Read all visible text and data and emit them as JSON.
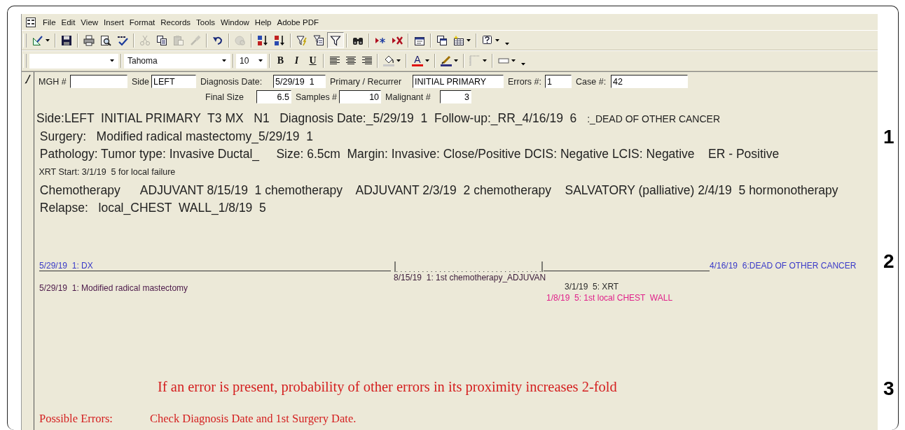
{
  "menu": {
    "items": [
      "File",
      "Edit",
      "View",
      "Insert",
      "Format",
      "Records",
      "Tools",
      "Window",
      "Help",
      "Adobe PDF"
    ]
  },
  "toolbar_1": {
    "groups": [
      {
        "buttons": [
          {
            "kind": "design",
            "disabled": false,
            "selected": false
          }
        ]
      },
      {
        "buttons": [
          {
            "kind": "save",
            "disabled": false,
            "selected": false
          }
        ]
      },
      {
        "buttons": [
          {
            "kind": "print",
            "disabled": false,
            "selected": false
          },
          {
            "kind": "preview",
            "disabled": false,
            "selected": false
          },
          {
            "kind": "spelling",
            "disabled": false,
            "selected": false
          }
        ]
      },
      {
        "buttons": [
          {
            "kind": "cut",
            "disabled": true,
            "selected": false
          },
          {
            "kind": "copy",
            "disabled": false,
            "selected": false
          },
          {
            "kind": "paste",
            "disabled": true,
            "selected": false
          },
          {
            "kind": "painter",
            "disabled": true,
            "selected": false
          }
        ]
      },
      {
        "buttons": [
          {
            "kind": "undo",
            "disabled": false,
            "selected": false
          }
        ]
      },
      {
        "buttons": [
          {
            "kind": "hyperlink",
            "disabled": true,
            "selected": false
          }
        ]
      },
      {
        "buttons": [
          {
            "kind": "sort_asc",
            "disabled": false,
            "selected": false
          },
          {
            "kind": "sort_desc",
            "disabled": false,
            "selected": false
          }
        ]
      },
      {
        "buttons": [
          {
            "kind": "filter_selection",
            "disabled": false,
            "selected": false
          },
          {
            "kind": "filter_form",
            "disabled": false,
            "selected": false
          },
          {
            "kind": "filter",
            "disabled": false,
            "selected": true
          }
        ]
      },
      {
        "buttons": [
          {
            "kind": "find",
            "disabled": false,
            "selected": false
          }
        ]
      },
      {
        "buttons": [
          {
            "kind": "new_record",
            "disabled": false,
            "selected": false
          },
          {
            "kind": "delete_record",
            "disabled": false,
            "selected": false
          }
        ]
      },
      {
        "buttons": [
          {
            "kind": "properties",
            "disabled": false,
            "selected": false
          }
        ]
      },
      {
        "buttons": [
          {
            "kind": "database_window",
            "disabled": false,
            "selected": false
          },
          {
            "kind": "new_object",
            "disabled": false,
            "selected": false
          }
        ]
      },
      {
        "buttons": [
          {
            "kind": "help",
            "disabled": false,
            "selected": false
          }
        ]
      }
    ]
  },
  "toolbar_2": {
    "font": "Tahoma",
    "font_size": "10",
    "format_buttons": [
      {
        "kind": "bold",
        "label": "B"
      },
      {
        "kind": "italic",
        "label": "I"
      },
      {
        "kind": "underline",
        "label": "U"
      }
    ],
    "color_buttons": [
      {
        "kind": "fill",
        "color": "#c8c8c8"
      },
      {
        "kind": "font",
        "label": "A",
        "color": "#e01010"
      },
      {
        "kind": "line",
        "color": "#303080"
      }
    ]
  },
  "form": {
    "header_fields": [
      {
        "label": "MGH #"
      },
      {
        "label": "Side",
        "value": "LEFT"
      },
      {
        "label": "Diagnosis Date:",
        "value": "5/29/19  1"
      },
      {
        "label": "Primary / Recurrer",
        "value": "INITIAL PRIMARY"
      },
      {
        "label": "Errors #:",
        "value": "1"
      },
      {
        "label": "Case #:",
        "value": "42"
      }
    ],
    "size_fields": [
      {
        "label": "Final Size",
        "value": "6.5"
      },
      {
        "label": "Samples #",
        "value": "10"
      },
      {
        "label": "Malignant #",
        "value": "3"
      }
    ]
  },
  "summary": {
    "marker": "1",
    "lines": [
      {
        "kind": "normal",
        "text": "Side:LEFT  INITIAL PRIMARY  T3 MX   N1   Diagnosis Date:_5/29/19  1  Follow-up:_RR_4/16/19  6",
        "note": ":_DEAD OF OTHER CANCER"
      },
      {
        "kind": "normal",
        "text": " Surgery:   Modified radical mastectomy_5/29/19  1"
      },
      {
        "kind": "normal",
        "text": " Pathology: Tumor type: Invasive Ductal_     Size: 6.5cm  Margin: Invasive: Close/Positive DCIS: Negative LCIS: Negative    ER - Positive"
      },
      {
        "kind": "small",
        "text": " XRT Start: 3/1/19  5 for local failure"
      },
      {
        "kind": "normal",
        "text": " Chemotherapy      ADJUVANT 8/15/19  1 chemotherapy    ADJUVANT 2/3/19  2 chemotherapy    SALVATORY (palliative) 2/4/19  5 hormonotherapy"
      },
      {
        "kind": "normal",
        "text": " Relapse:   local_CHEST  WALL_1/8/19  5"
      }
    ]
  },
  "timeline": {
    "marker": "2",
    "events": [
      {
        "text": "5/29/19  1: DX",
        "color": "#3a3ac8"
      },
      {
        "text": "4/16/19  6:DEAD OF OTHER CANCER",
        "color": "#3a3ac8"
      },
      {
        "text": "5/29/19  1: Modified radical mastectomy",
        "color": "#4a1848"
      },
      {
        "text": "8/15/19  1: 1st chemotherapy_ADJUVAN",
        "color": "#3a1a38"
      },
      {
        "text": "3/1/19  5: XRT",
        "color": "#2a2a2a"
      },
      {
        "text": "1/8/19  5: 1st local CHEST  WALL",
        "color": "#e0208a"
      }
    ]
  },
  "errors": {
    "marker": "3",
    "notice": "If an error is present, probability of other errors in its proximity increases 2-fold",
    "label": "Possible Errors:",
    "message": "Check Diagnosis Date and 1st Surgery Date."
  }
}
